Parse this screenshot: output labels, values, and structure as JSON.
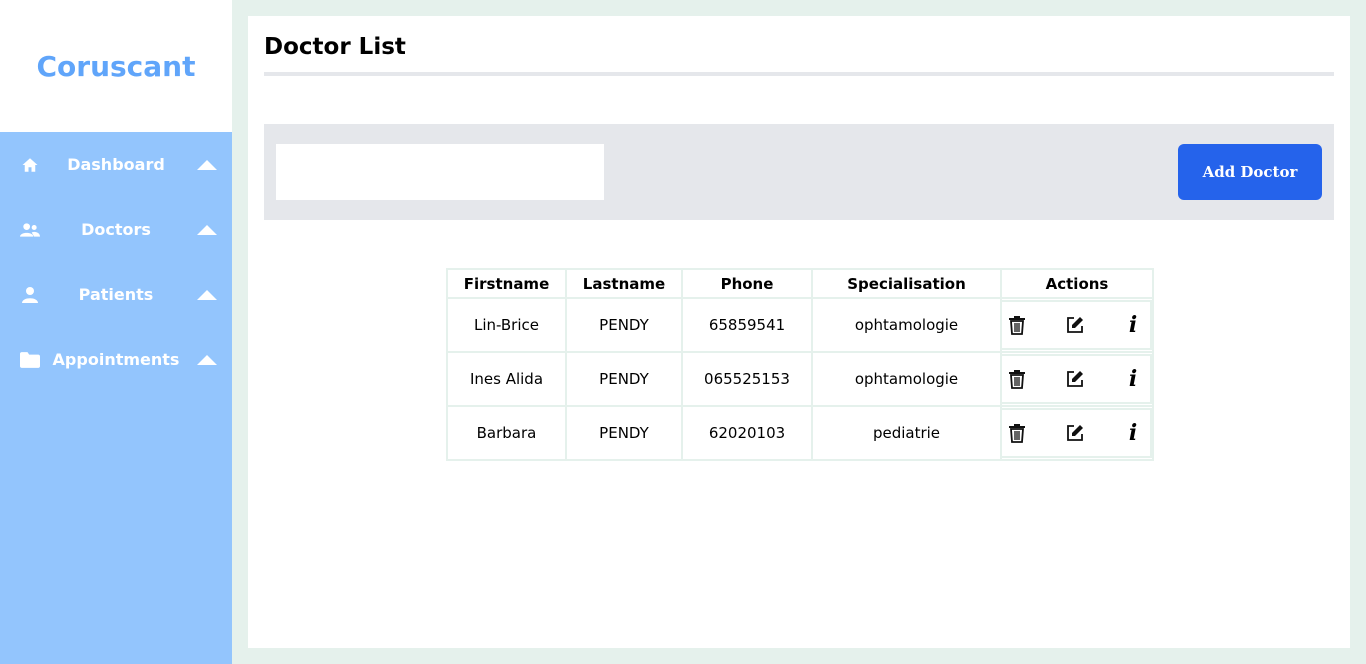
{
  "brand": {
    "name": "Coruscant"
  },
  "sidebar": {
    "items": [
      {
        "label": "Dashboard",
        "icon": "home-icon"
      },
      {
        "label": "Doctors",
        "icon": "users-icon"
      },
      {
        "label": "Patients",
        "icon": "user-icon"
      },
      {
        "label": "Appointments",
        "icon": "folder-icon"
      }
    ]
  },
  "page": {
    "title": "Doctor List"
  },
  "toolbar": {
    "search_value": "",
    "add_label": "Add Doctor"
  },
  "table": {
    "headers": [
      "Firstname",
      "Lastname",
      "Phone",
      "Specialisation",
      "Actions"
    ],
    "rows": [
      {
        "firstname": "Lin-Brice",
        "lastname": "PENDY",
        "phone": "65859541",
        "specialisation": "ophtamologie"
      },
      {
        "firstname": "Ines Alida",
        "lastname": "PENDY",
        "phone": "065525153",
        "specialisation": "ophtamologie"
      },
      {
        "firstname": "Barbara",
        "lastname": "PENDY",
        "phone": "62020103",
        "specialisation": "pediatrie"
      }
    ],
    "action_icons": [
      "trash-icon",
      "edit-icon",
      "info-icon"
    ],
    "info_glyph": "i"
  },
  "colors": {
    "sidebar_bg": "#93c5fd",
    "brand_text": "#60a5fa",
    "primary_button": "#2563eb",
    "toolbar_bg": "#e5e7eb",
    "page_bg": "#e5f1ec"
  }
}
